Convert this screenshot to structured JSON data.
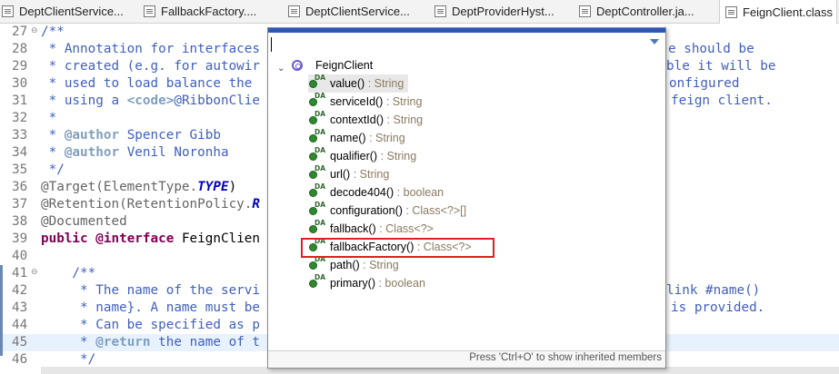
{
  "tabs": [
    {
      "label": "DeptClientService..."
    },
    {
      "label": "FallbackFactory...."
    },
    {
      "label": "DeptClientService..."
    },
    {
      "label": "DeptProviderHyst..."
    },
    {
      "label": "DeptController.ja..."
    },
    {
      "label": "FeignClient.class"
    }
  ],
  "code_lines": [
    {
      "num": "27",
      "segments": [
        {
          "t": "/**",
          "s": "c"
        }
      ]
    },
    {
      "num": "28",
      "segments": [
        {
          "t": " * Annotation for interfaces",
          "s": "c"
        }
      ]
    },
    {
      "num": "29",
      "segments": [
        {
          "t": " * created (e.g. for autowir",
          "s": "c"
        }
      ]
    },
    {
      "num": "30",
      "segments": [
        {
          "t": " * used to load balance the",
          "s": "c"
        }
      ]
    },
    {
      "num": "31",
      "segments": [
        {
          "t": " * using a ",
          "s": "c"
        },
        {
          "t": "<code>",
          "s": "tag"
        },
        {
          "t": "@RibbonClie",
          "s": "c"
        }
      ]
    },
    {
      "num": "32",
      "segments": [
        {
          "t": " *",
          "s": "c"
        }
      ]
    },
    {
      "num": "33",
      "segments": [
        {
          "t": " * ",
          "s": "c"
        },
        {
          "t": "@author",
          "s": "tag"
        },
        {
          "t": " Spencer Gibb",
          "s": "c"
        }
      ]
    },
    {
      "num": "34",
      "segments": [
        {
          "t": " * ",
          "s": "c"
        },
        {
          "t": "@author",
          "s": "tag"
        },
        {
          "t": " Venil Noronha",
          "s": "c"
        }
      ]
    },
    {
      "num": "35",
      "segments": [
        {
          "t": " */",
          "s": "c"
        }
      ]
    },
    {
      "num": "36",
      "segments": [
        {
          "t": "@Target(ElementType.",
          "s": "ann"
        },
        {
          "t": "TYPE",
          "s": "it"
        },
        {
          "t": ")",
          "s": "n"
        }
      ]
    },
    {
      "num": "37",
      "segments": [
        {
          "t": "@Retention(RetentionPolicy.",
          "s": "ann"
        },
        {
          "t": "R",
          "s": "it"
        }
      ]
    },
    {
      "num": "38",
      "segments": [
        {
          "t": "@Documented",
          "s": "ann"
        }
      ]
    },
    {
      "num": "39",
      "segments": [
        {
          "t": "public",
          "s": "kw"
        },
        {
          "t": " ",
          "s": "n"
        },
        {
          "t": "@interface",
          "s": "kw"
        },
        {
          "t": " FeignClien",
          "s": "n"
        }
      ]
    },
    {
      "num": "40",
      "segments": [
        {
          "t": "",
          "s": "n"
        }
      ]
    },
    {
      "num": "41",
      "segments": [
        {
          "t": "    /**",
          "s": "c"
        }
      ]
    },
    {
      "num": "42",
      "segments": [
        {
          "t": "     * The name of the servi",
          "s": "c"
        }
      ]
    },
    {
      "num": "43",
      "segments": [
        {
          "t": "     * name}. A name must be",
          "s": "c"
        }
      ]
    },
    {
      "num": "44",
      "segments": [
        {
          "t": "     * Can be specified as p",
          "s": "c"
        }
      ]
    },
    {
      "num": "45",
      "segments": [
        {
          "t": "     * ",
          "s": "c"
        },
        {
          "t": "@return",
          "s": "tag"
        },
        {
          "t": " the name of t",
          "s": "c"
        }
      ]
    },
    {
      "num": "46",
      "segments": [
        {
          "t": "     */",
          "s": "c"
        }
      ]
    }
  ],
  "code_right": [
    {
      "text": "e should be"
    },
    {
      "text": "ble it will be"
    },
    {
      "text": "onfigured"
    },
    {
      "text": "feign client."
    },
    {
      "text": "link #name()"
    },
    {
      "text": "is provided."
    }
  ],
  "popup": {
    "filter_value": "",
    "root_label": "FeignClient",
    "members": [
      {
        "name": "value()",
        "type": " : String"
      },
      {
        "name": "serviceId()",
        "type": " : String"
      },
      {
        "name": "contextId()",
        "type": " : String"
      },
      {
        "name": "name()",
        "type": " : String"
      },
      {
        "name": "qualifier()",
        "type": " : String"
      },
      {
        "name": "url()",
        "type": " : String"
      },
      {
        "name": "decode404()",
        "type": " : boolean"
      },
      {
        "name": "configuration()",
        "type": " : Class<?>[]"
      },
      {
        "name": "fallback()",
        "type": " : Class<?>"
      },
      {
        "name": "fallbackFactory()",
        "type": " : Class<?>"
      },
      {
        "name": "path()",
        "type": " : String"
      },
      {
        "name": "primary()",
        "type": " : boolean"
      }
    ],
    "status_text": "Press 'Ctrl+O' to show inherited members"
  },
  "colors": {
    "comment": "#3f5fbf",
    "keyword": "#7f0055",
    "highlight_box": "#e02020",
    "method_icon": "#2f8a2f"
  }
}
